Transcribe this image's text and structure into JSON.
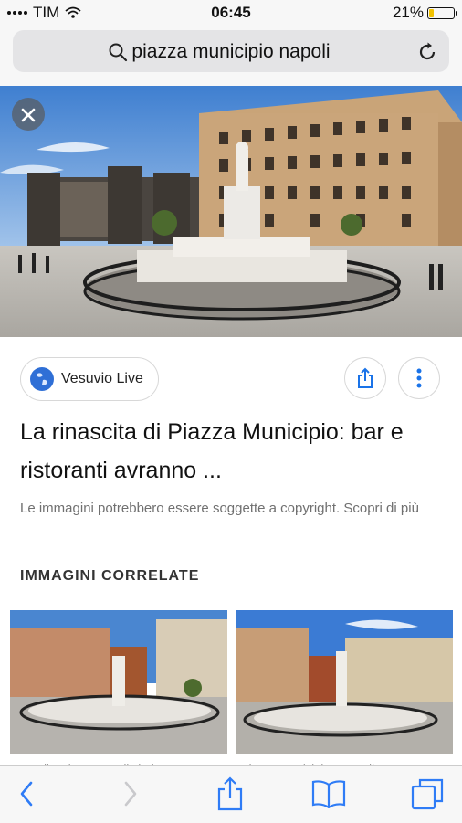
{
  "status": {
    "carrier": "TIM",
    "time": "06:45",
    "battery": "21%",
    "battery_level": 0.21
  },
  "urlbar": {
    "query": "piazza municipio napoli"
  },
  "result": {
    "source": "Vesuvio Live",
    "title": "La rinascita di Piazza Municipio: bar e ristoranti avranno ...",
    "copyright": "Le immagini potrebbero essere soggette a copyright. Scopri di più"
  },
  "related": {
    "heading": "IMMAGINI CORRELATE",
    "items": [
      {
        "caption": "Napoli, sgitto contro il sindaco e..."
      },
      {
        "caption": "Piazza Municipio - Napoli - Foto..."
      }
    ]
  },
  "colors": {
    "accent": "#1a73e8",
    "safari_blue": "#2f7cf6"
  }
}
